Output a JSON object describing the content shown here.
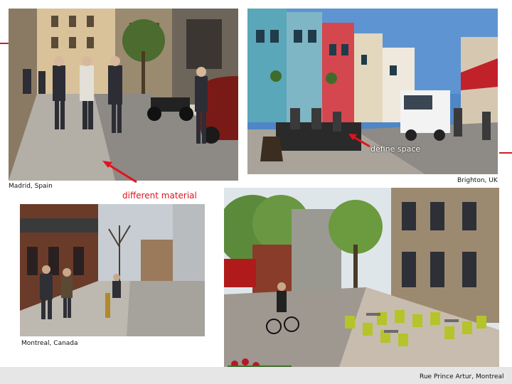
{
  "captions": {
    "madrid": "Madrid, Spain",
    "brighton": "Brighton, UK",
    "montreal": "Montreal, Canada",
    "rue_prince": "Rue Prince Artur, Montreal"
  },
  "annotations": {
    "different_material": "different material",
    "define_space": "define space"
  },
  "colors": {
    "annotation": "#e0141e",
    "arrow": "#e0141e",
    "side_marks": "#c8202a"
  }
}
